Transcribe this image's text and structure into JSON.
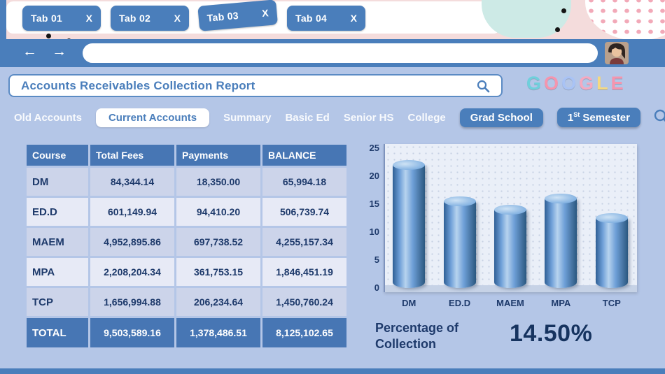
{
  "browser": {
    "tabs": [
      {
        "label": "Tab 01",
        "close": "X"
      },
      {
        "label": "Tab 02",
        "close": "X"
      },
      {
        "label": "Tab 03",
        "close": "X"
      },
      {
        "label": "Tab 04",
        "close": "X"
      }
    ],
    "new_tab_label": "+"
  },
  "toolbar": {
    "back": "←",
    "forward": "→",
    "address_placeholder": ""
  },
  "report": {
    "title": "Accounts Receivables Collection Report",
    "logo_letters": [
      {
        "char": "G",
        "color": "#6fd0dc"
      },
      {
        "char": "O",
        "color": "#f595ae"
      },
      {
        "char": "O",
        "color": "#a9c3f5"
      },
      {
        "char": "G",
        "color": "#f5a9c0"
      },
      {
        "char": "L",
        "color": "#f5d982"
      },
      {
        "char": "E",
        "color": "#f595ae"
      }
    ]
  },
  "nav": {
    "items": [
      {
        "label": "Old Accounts",
        "style": "plain"
      },
      {
        "label": "Current Accounts",
        "style": "active"
      },
      {
        "label": "Summary",
        "style": "plain"
      },
      {
        "label": "Basic Ed",
        "style": "plain"
      },
      {
        "label": "Senior HS",
        "style": "plain"
      },
      {
        "label": "College",
        "style": "plain"
      },
      {
        "label": "Grad School",
        "style": "button"
      },
      {
        "parts": {
          "pre": "1",
          "sup": "St",
          "post": " Semester"
        },
        "style": "button",
        "name": "1st-semester"
      }
    ]
  },
  "table": {
    "headers": [
      "Course",
      "Total Fees",
      "Payments",
      "BALANCE"
    ],
    "rows": [
      [
        "DM",
        "84,344.14",
        "18,350.00",
        "65,994.18"
      ],
      [
        "ED.D",
        "601,149.94",
        "94,410.20",
        "506,739.74"
      ],
      [
        "MAEM",
        "4,952,895.86",
        "697,738.52",
        "4,255,157.34"
      ],
      [
        "MPA",
        "2,208,204.34",
        "361,753.15",
        "1,846,451.19"
      ],
      [
        "TCP",
        "1,656,994.88",
        "206,234.64",
        "1,450,760.24"
      ]
    ],
    "total": [
      "TOTAL",
      "9,503,589.16",
      "1,378,486.51",
      "8,125,102.65"
    ]
  },
  "chart_data": {
    "type": "bar",
    "title": "",
    "categories": [
      "DM",
      "ED.D",
      "MAEM",
      "MPA",
      "TCP"
    ],
    "values": [
      22,
      15.5,
      14,
      16,
      12.5
    ],
    "yticks": [
      0,
      5,
      10,
      15,
      20,
      25
    ],
    "ylim": [
      0,
      25
    ],
    "xlabel": "",
    "ylabel": "",
    "grid": false,
    "legend": false
  },
  "summary": {
    "label_line1": "Percentage of",
    "label_line2": "Collection",
    "value": "14.50%"
  },
  "colors": {
    "primary": "#4a7ebb",
    "navy": "#1e3a6b",
    "row_dark": "#ccd4ea",
    "row_light": "#e7eaf6",
    "header_pink": "#f4dcdc",
    "teal_blob": "#cdeae6"
  }
}
